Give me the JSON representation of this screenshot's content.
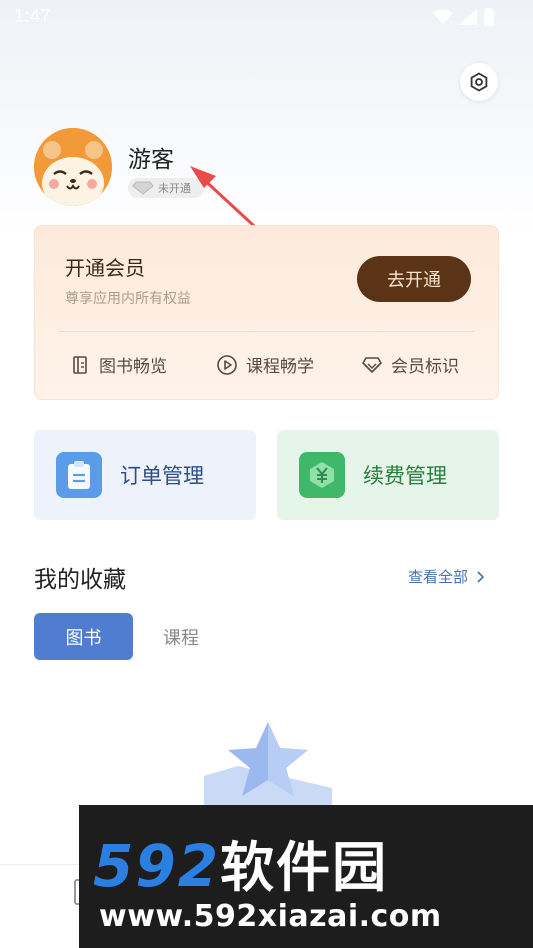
{
  "status_bar": {
    "time": "1:47"
  },
  "profile": {
    "name": "游客",
    "badge": "未开通"
  },
  "vip_card": {
    "title": "开通会员",
    "subtitle": "尊享应用内所有权益",
    "button": "去开通",
    "perks": [
      {
        "label": "图书畅览",
        "icon": "book-icon"
      },
      {
        "label": "课程畅学",
        "icon": "play-icon"
      },
      {
        "label": "会员标识",
        "icon": "diamond-icon"
      }
    ]
  },
  "tiles": {
    "order": {
      "label": "订单管理",
      "icon": "clipboard-icon",
      "color": "#5a9ce8"
    },
    "renew": {
      "label": "续费管理",
      "icon": "yuan-icon",
      "color": "#3fb86a"
    }
  },
  "favorites": {
    "title": "我的收藏",
    "view_all": "查看全部",
    "tabs": [
      "图书",
      "课程"
    ]
  },
  "watermark": {
    "brand_num": "592",
    "brand_cn": "软件园",
    "url": "www.592xiazai.com"
  },
  "colors": {
    "accent": "#4f7dd0",
    "vip_button": "#5b3316",
    "arrow": "#e94a4a"
  }
}
